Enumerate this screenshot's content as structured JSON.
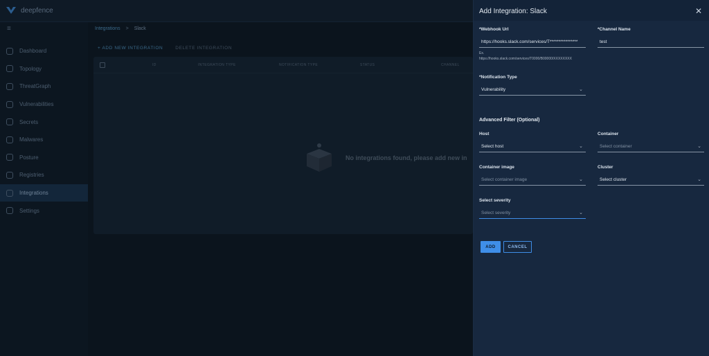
{
  "app": {
    "name": "deepfence"
  },
  "sidebar": {
    "items": [
      {
        "label": "Dashboard",
        "icon": "dashboard-icon"
      },
      {
        "label": "Topology",
        "icon": "topology-icon"
      },
      {
        "label": "ThreatGraph",
        "icon": "threatgraph-icon"
      },
      {
        "label": "Vulnerabilities",
        "icon": "bug-icon"
      },
      {
        "label": "Secrets",
        "icon": "lock-icon"
      },
      {
        "label": "Malwares",
        "icon": "malware-icon"
      },
      {
        "label": "Posture",
        "icon": "shield-icon"
      },
      {
        "label": "Registries",
        "icon": "registry-icon"
      },
      {
        "label": "Integrations",
        "icon": "plug-icon",
        "active": true
      },
      {
        "label": "Settings",
        "icon": "gear-icon"
      }
    ]
  },
  "breadcrumb": {
    "parent": "Integrations",
    "separator": ">",
    "current": "Slack"
  },
  "actions": {
    "add": "+ ADD NEW INTEGRATION",
    "delete": "DELETE INTEGRATION"
  },
  "table": {
    "columns": [
      "ID",
      "INTEGRATION TYPE",
      "NOTIFICATION TYPE",
      "STATUS",
      "CHANNEL"
    ],
    "empty_message": "No integrations found, please add new in"
  },
  "drawer": {
    "title": "Add Integration: Slack",
    "webhook": {
      "label": "*Webhook Url",
      "value": "https://hooks.slack.com/services/T****************",
      "hint_prefix": "Ex.",
      "hint_example": "https://hooks.slack.com/services/T0000/B00000/XXXXXXXX"
    },
    "channel": {
      "label": "*Channel Name",
      "value": "test"
    },
    "notification_type": {
      "label": "*Notification Type",
      "value": "Vulnerability"
    },
    "advanced_filter_title": "Advanced Filter (Optional)",
    "host": {
      "label": "Host",
      "value": "Select host"
    },
    "container": {
      "label": "Container",
      "placeholder": "Select container"
    },
    "container_image": {
      "label": "Container image",
      "placeholder": "Select container image"
    },
    "cluster": {
      "label": "Cluster",
      "value": "Select cluster"
    },
    "severity": {
      "label": "Select severity",
      "placeholder": "Select severity"
    },
    "add_button": "ADD",
    "cancel_button": "CANCEL"
  },
  "colors": {
    "accent": "#3f8ee8",
    "drawer_bg": "#17283f",
    "page_bg": "#0e1722"
  }
}
